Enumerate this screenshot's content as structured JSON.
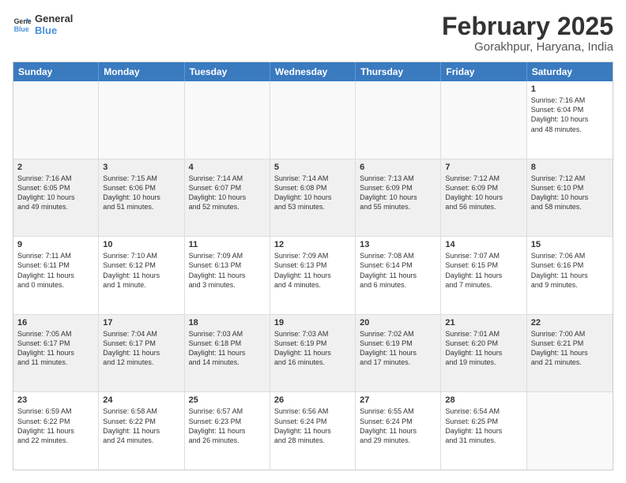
{
  "logo": {
    "line1": "General",
    "line2": "Blue"
  },
  "title": "February 2025",
  "location": "Gorakhpur, Haryana, India",
  "header_days": [
    "Sunday",
    "Monday",
    "Tuesday",
    "Wednesday",
    "Thursday",
    "Friday",
    "Saturday"
  ],
  "weeks": [
    {
      "cells": [
        {
          "day": "",
          "info": "",
          "empty": true
        },
        {
          "day": "",
          "info": "",
          "empty": true
        },
        {
          "day": "",
          "info": "",
          "empty": true
        },
        {
          "day": "",
          "info": "",
          "empty": true
        },
        {
          "day": "",
          "info": "",
          "empty": true
        },
        {
          "day": "",
          "info": "",
          "empty": true
        },
        {
          "day": "1",
          "info": "Sunrise: 7:16 AM\nSunset: 6:04 PM\nDaylight: 10 hours\nand 48 minutes.",
          "empty": false
        }
      ]
    },
    {
      "cells": [
        {
          "day": "2",
          "info": "Sunrise: 7:16 AM\nSunset: 6:05 PM\nDaylight: 10 hours\nand 49 minutes.",
          "empty": false
        },
        {
          "day": "3",
          "info": "Sunrise: 7:15 AM\nSunset: 6:06 PM\nDaylight: 10 hours\nand 51 minutes.",
          "empty": false
        },
        {
          "day": "4",
          "info": "Sunrise: 7:14 AM\nSunset: 6:07 PM\nDaylight: 10 hours\nand 52 minutes.",
          "empty": false
        },
        {
          "day": "5",
          "info": "Sunrise: 7:14 AM\nSunset: 6:08 PM\nDaylight: 10 hours\nand 53 minutes.",
          "empty": false
        },
        {
          "day": "6",
          "info": "Sunrise: 7:13 AM\nSunset: 6:09 PM\nDaylight: 10 hours\nand 55 minutes.",
          "empty": false
        },
        {
          "day": "7",
          "info": "Sunrise: 7:12 AM\nSunset: 6:09 PM\nDaylight: 10 hours\nand 56 minutes.",
          "empty": false
        },
        {
          "day": "8",
          "info": "Sunrise: 7:12 AM\nSunset: 6:10 PM\nDaylight: 10 hours\nand 58 minutes.",
          "empty": false
        }
      ]
    },
    {
      "cells": [
        {
          "day": "9",
          "info": "Sunrise: 7:11 AM\nSunset: 6:11 PM\nDaylight: 11 hours\nand 0 minutes.",
          "empty": false
        },
        {
          "day": "10",
          "info": "Sunrise: 7:10 AM\nSunset: 6:12 PM\nDaylight: 11 hours\nand 1 minute.",
          "empty": false
        },
        {
          "day": "11",
          "info": "Sunrise: 7:09 AM\nSunset: 6:13 PM\nDaylight: 11 hours\nand 3 minutes.",
          "empty": false
        },
        {
          "day": "12",
          "info": "Sunrise: 7:09 AM\nSunset: 6:13 PM\nDaylight: 11 hours\nand 4 minutes.",
          "empty": false
        },
        {
          "day": "13",
          "info": "Sunrise: 7:08 AM\nSunset: 6:14 PM\nDaylight: 11 hours\nand 6 minutes.",
          "empty": false
        },
        {
          "day": "14",
          "info": "Sunrise: 7:07 AM\nSunset: 6:15 PM\nDaylight: 11 hours\nand 7 minutes.",
          "empty": false
        },
        {
          "day": "15",
          "info": "Sunrise: 7:06 AM\nSunset: 6:16 PM\nDaylight: 11 hours\nand 9 minutes.",
          "empty": false
        }
      ]
    },
    {
      "cells": [
        {
          "day": "16",
          "info": "Sunrise: 7:05 AM\nSunset: 6:17 PM\nDaylight: 11 hours\nand 11 minutes.",
          "empty": false
        },
        {
          "day": "17",
          "info": "Sunrise: 7:04 AM\nSunset: 6:17 PM\nDaylight: 11 hours\nand 12 minutes.",
          "empty": false
        },
        {
          "day": "18",
          "info": "Sunrise: 7:03 AM\nSunset: 6:18 PM\nDaylight: 11 hours\nand 14 minutes.",
          "empty": false
        },
        {
          "day": "19",
          "info": "Sunrise: 7:03 AM\nSunset: 6:19 PM\nDaylight: 11 hours\nand 16 minutes.",
          "empty": false
        },
        {
          "day": "20",
          "info": "Sunrise: 7:02 AM\nSunset: 6:19 PM\nDaylight: 11 hours\nand 17 minutes.",
          "empty": false
        },
        {
          "day": "21",
          "info": "Sunrise: 7:01 AM\nSunset: 6:20 PM\nDaylight: 11 hours\nand 19 minutes.",
          "empty": false
        },
        {
          "day": "22",
          "info": "Sunrise: 7:00 AM\nSunset: 6:21 PM\nDaylight: 11 hours\nand 21 minutes.",
          "empty": false
        }
      ]
    },
    {
      "cells": [
        {
          "day": "23",
          "info": "Sunrise: 6:59 AM\nSunset: 6:22 PM\nDaylight: 11 hours\nand 22 minutes.",
          "empty": false
        },
        {
          "day": "24",
          "info": "Sunrise: 6:58 AM\nSunset: 6:22 PM\nDaylight: 11 hours\nand 24 minutes.",
          "empty": false
        },
        {
          "day": "25",
          "info": "Sunrise: 6:57 AM\nSunset: 6:23 PM\nDaylight: 11 hours\nand 26 minutes.",
          "empty": false
        },
        {
          "day": "26",
          "info": "Sunrise: 6:56 AM\nSunset: 6:24 PM\nDaylight: 11 hours\nand 28 minutes.",
          "empty": false
        },
        {
          "day": "27",
          "info": "Sunrise: 6:55 AM\nSunset: 6:24 PM\nDaylight: 11 hours\nand 29 minutes.",
          "empty": false
        },
        {
          "day": "28",
          "info": "Sunrise: 6:54 AM\nSunset: 6:25 PM\nDaylight: 11 hours\nand 31 minutes.",
          "empty": false
        },
        {
          "day": "",
          "info": "",
          "empty": true
        }
      ]
    }
  ]
}
